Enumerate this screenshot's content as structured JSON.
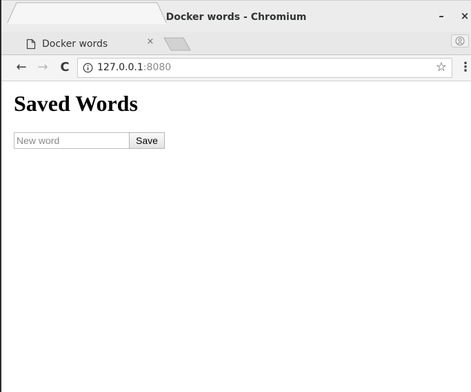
{
  "window": {
    "title": "Docker words - Chromium",
    "minimize_glyph": "–",
    "close_glyph": "×"
  },
  "tabs": [
    {
      "title": "Docker words",
      "icon": "page-icon",
      "close_glyph": "×",
      "active": true
    }
  ],
  "toolbar": {
    "back_glyph": "←",
    "forward_glyph": "→",
    "reload_glyph": "C",
    "url_host": "127.0.0.1",
    "url_port": ":8080",
    "bookmark_glyph": "☆",
    "menu_glyph": "⋮"
  },
  "page": {
    "heading": "Saved Words",
    "input_placeholder": "New word",
    "input_value": "",
    "save_label": "Save"
  },
  "colors": {
    "titlebar_bg": "#ececec",
    "toolbar_bg": "#f4f4f4",
    "forward_disabled": "#b8b8b8",
    "url_port": "#888888"
  }
}
